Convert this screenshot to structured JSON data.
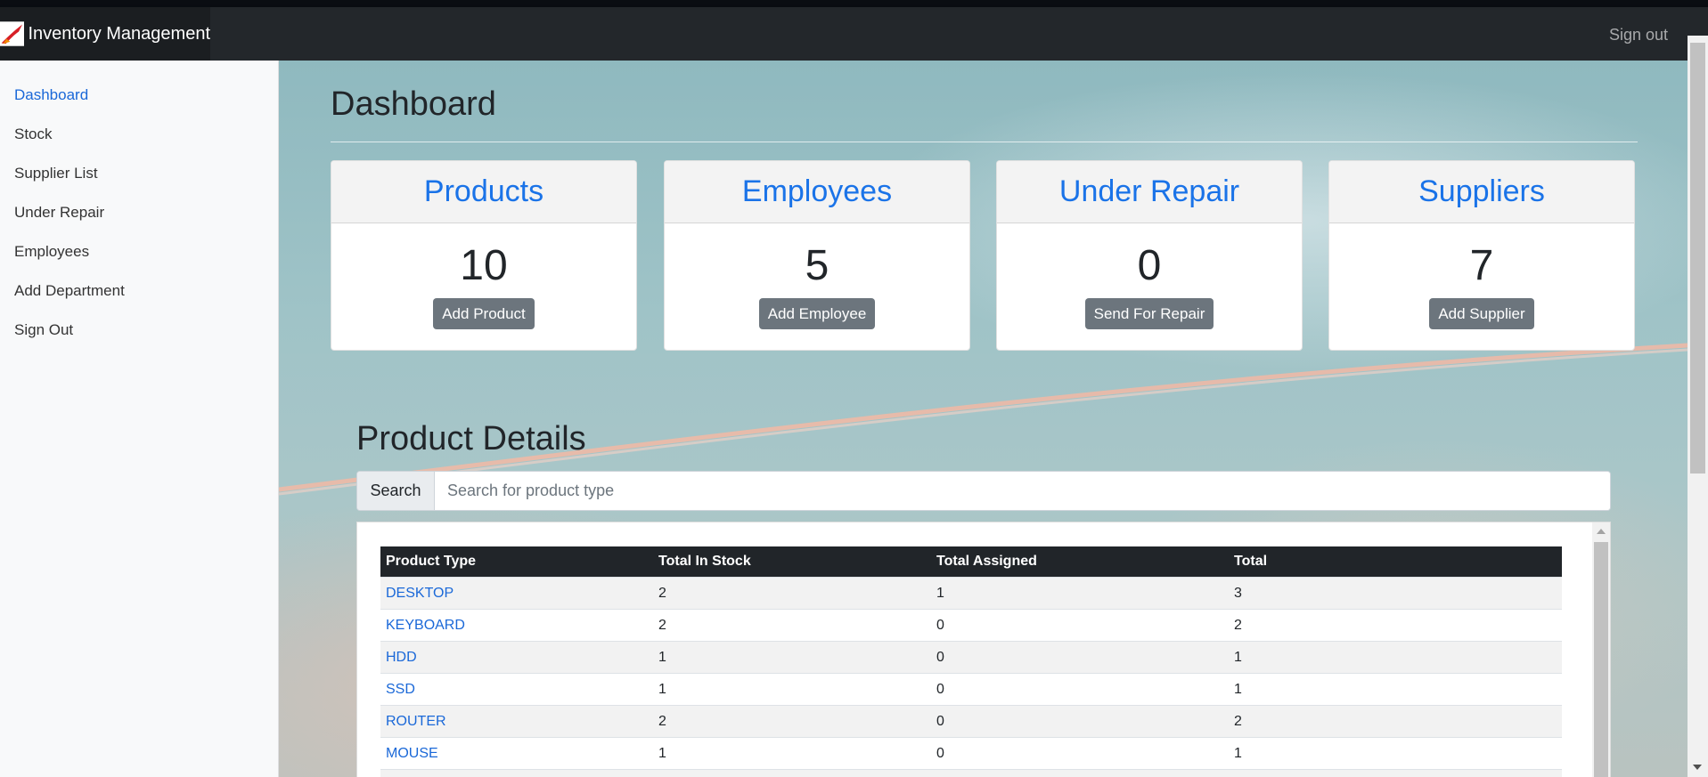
{
  "navbar": {
    "brand": "Inventory Management",
    "signout": "Sign out"
  },
  "sidebar": {
    "items": [
      {
        "label": "Dashboard",
        "active": true
      },
      {
        "label": "Stock"
      },
      {
        "label": "Supplier List"
      },
      {
        "label": "Under Repair"
      },
      {
        "label": "Employees"
      },
      {
        "label": "Add Department"
      },
      {
        "label": "Sign Out"
      }
    ]
  },
  "main": {
    "title": "Dashboard",
    "cards": [
      {
        "title": "Products",
        "count": "10",
        "button": "Add Product"
      },
      {
        "title": "Employees",
        "count": "5",
        "button": "Add Employee"
      },
      {
        "title": "Under Repair",
        "count": "0",
        "button": "Send For Repair"
      },
      {
        "title": "Suppliers",
        "count": "7",
        "button": "Add Supplier"
      }
    ],
    "section_title": "Product Details",
    "search": {
      "label": "Search",
      "placeholder": "Search for product type",
      "value": ""
    },
    "table": {
      "headers": [
        "Product Type",
        "Total In Stock",
        "Total Assigned",
        "Total"
      ],
      "rows": [
        [
          "DESKTOP",
          "2",
          "1",
          "3"
        ],
        [
          "KEYBOARD",
          "2",
          "0",
          "2"
        ],
        [
          "HDD",
          "1",
          "0",
          "1"
        ],
        [
          "SSD",
          "1",
          "0",
          "1"
        ],
        [
          "ROUTER",
          "2",
          "0",
          "2"
        ],
        [
          "MOUSE",
          "1",
          "0",
          "1"
        ]
      ]
    }
  },
  "colors": {
    "navbar": "#23272b",
    "accent": "#1a73e8",
    "button": "#6c757d",
    "table_header": "#212529"
  }
}
